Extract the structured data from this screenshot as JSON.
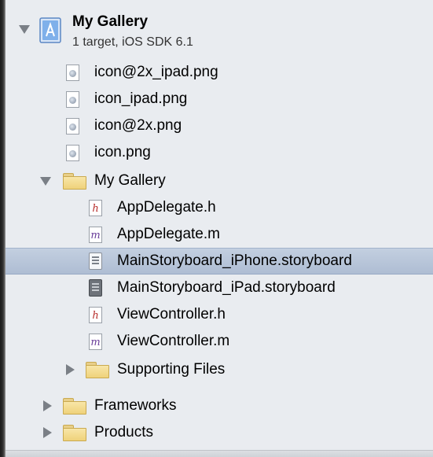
{
  "project": {
    "title": "My Gallery",
    "subtitle": "1 target, iOS SDK 6.1",
    "icon": "xcode-project-icon"
  },
  "files": [
    {
      "label": "icon@2x_ipad.png",
      "icon": "image-file-icon"
    },
    {
      "label": "icon_ipad.png",
      "icon": "image-file-icon"
    },
    {
      "label": "icon@2x.png",
      "icon": "image-file-icon"
    },
    {
      "label": "icon.png",
      "icon": "image-file-icon"
    }
  ],
  "group": {
    "label": "My Gallery",
    "icon": "folder-icon",
    "children": [
      {
        "label": "AppDelegate.h",
        "icon": "header-file-icon",
        "glyph": "h",
        "color": "#b8312f"
      },
      {
        "label": "AppDelegate.m",
        "icon": "source-file-icon",
        "glyph": "m",
        "color": "#6a3e9a"
      },
      {
        "label": "MainStoryboard_iPhone.storyboard",
        "icon": "storyboard-icon",
        "selected": true
      },
      {
        "label": "MainStoryboard_iPad.storyboard",
        "icon": "storyboard-icon"
      },
      {
        "label": "ViewController.h",
        "icon": "header-file-icon",
        "glyph": "h",
        "color": "#b8312f"
      },
      {
        "label": "ViewController.m",
        "icon": "source-file-icon",
        "glyph": "m",
        "color": "#6a3e9a"
      }
    ],
    "subgroup": {
      "label": "Supporting Files",
      "icon": "folder-icon"
    }
  },
  "folders": [
    {
      "label": "Frameworks",
      "icon": "folder-icon"
    },
    {
      "label": "Products",
      "icon": "folder-icon"
    }
  ],
  "colors": {
    "selection": "#b3c2d8",
    "navigator_bg": "#e9ecf0"
  }
}
